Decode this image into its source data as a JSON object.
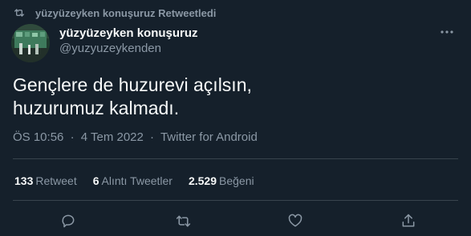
{
  "retweet_banner": {
    "text": "yüzyüzeyken konuşuruz Retweetledi",
    "icon": "retweet-icon"
  },
  "author": {
    "name": "yüzyüzeyken konuşuruz",
    "handle": "@yuzyuzeykenden"
  },
  "tweet": {
    "text": "Gençlere de huzurevi açılsın,\nhuzurumuz kalmadı."
  },
  "meta": {
    "time": "ÖS 10:56",
    "date": "4 Tem 2022",
    "source": "Twitter for Android",
    "separator": "·"
  },
  "stats": {
    "retweets_count": "133",
    "retweets_label": "Retweet",
    "quotes_count": "6",
    "quotes_label": "Alıntı Tweetler",
    "likes_count": "2.529",
    "likes_label": "Beğeni"
  },
  "actions": [
    "reply-icon",
    "retweet-icon",
    "like-icon",
    "share-icon"
  ],
  "colors": {
    "background": "#15202b",
    "text_primary": "#f7f9f9",
    "text_secondary": "#8b98a5",
    "divider": "#38444d"
  }
}
